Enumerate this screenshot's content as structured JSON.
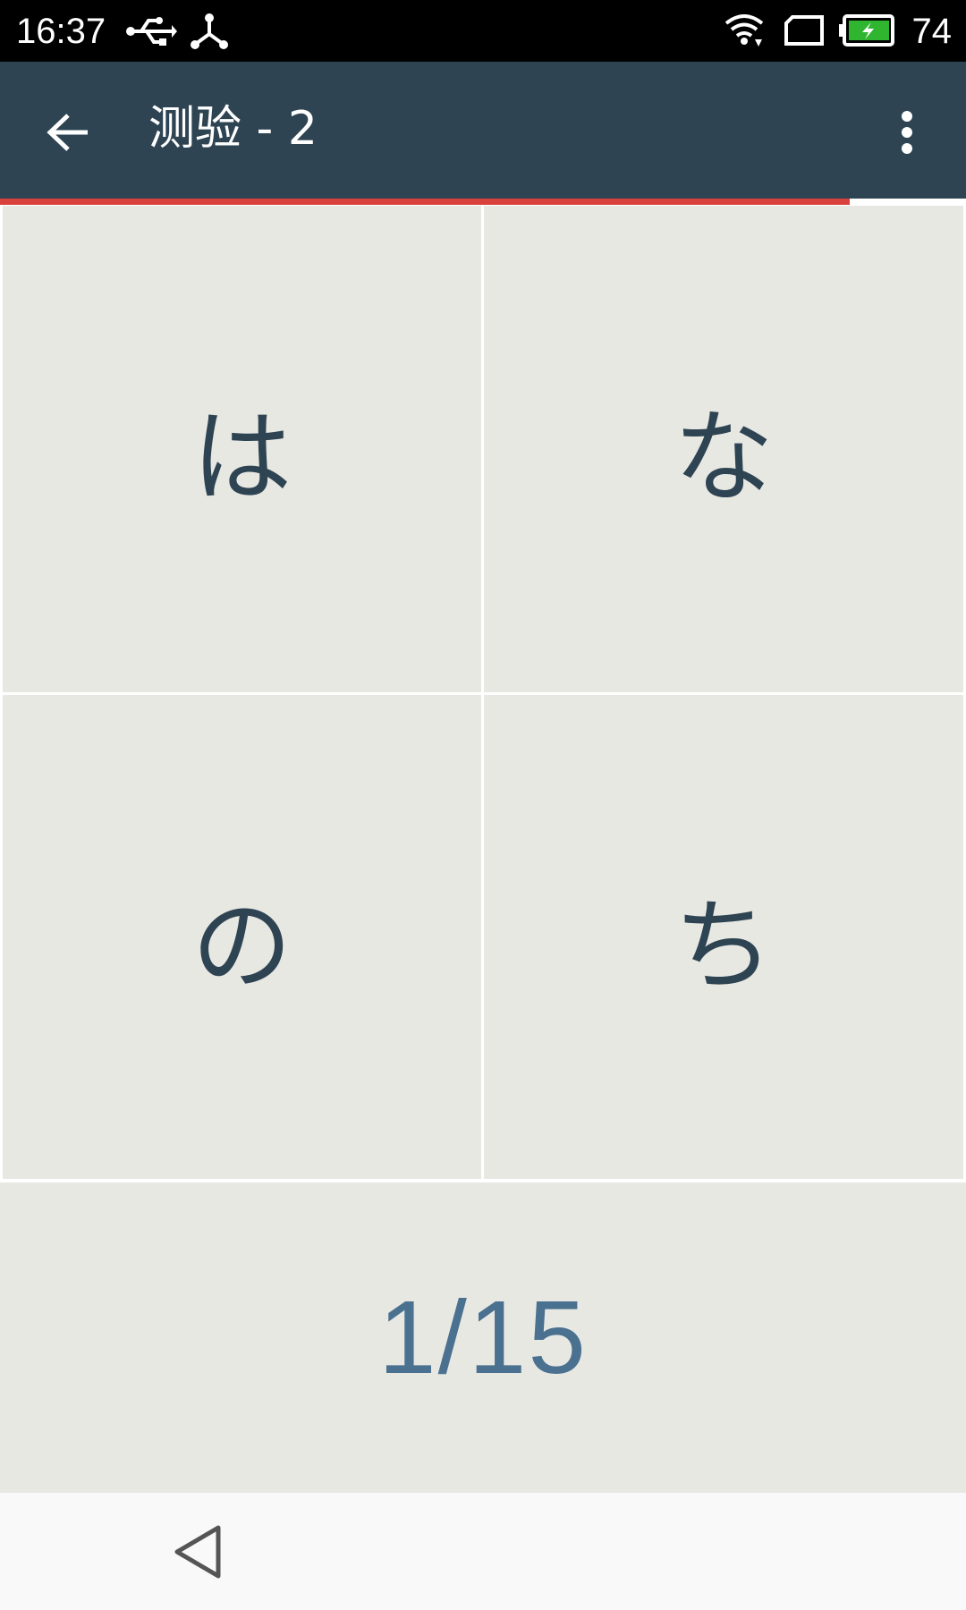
{
  "status_bar": {
    "time": "16:37",
    "battery_level": "74",
    "icons": [
      "usb-icon",
      "share-icon",
      "wifi-icon",
      "screen-icon",
      "battery-icon"
    ]
  },
  "app_bar": {
    "title": "测验 - 2",
    "icons": [
      "back-arrow-icon",
      "more-vert-icon"
    ]
  },
  "progress": {
    "fraction": 0.88,
    "color": "#d9413d"
  },
  "choices": [
    {
      "label": "は"
    },
    {
      "label": "な"
    },
    {
      "label": "の"
    },
    {
      "label": "ち"
    }
  ],
  "counter": {
    "text": "1/15"
  },
  "nav_bar": {
    "icons": [
      "nav-back-icon"
    ]
  },
  "colors": {
    "app_bar": "#2e4453",
    "cell_background": "#e8e8e3",
    "choice_text": "#2e4453",
    "counter_text": "#4b7190",
    "battery_fill": "#2fb52f"
  }
}
